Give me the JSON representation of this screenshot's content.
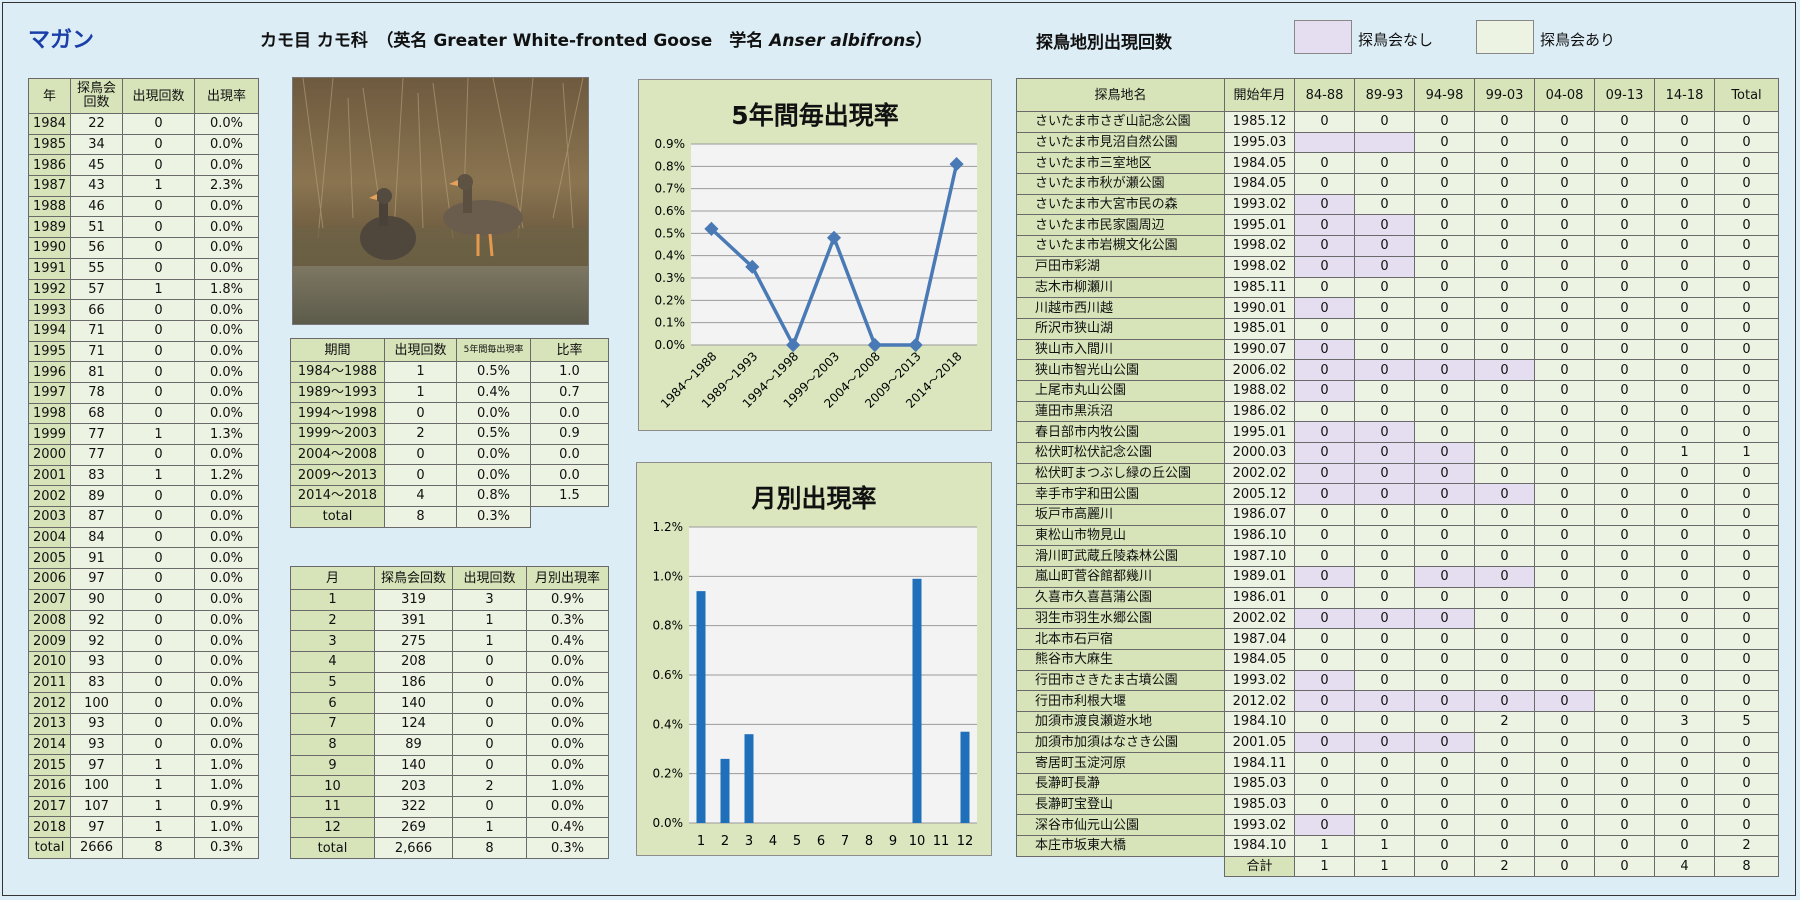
{
  "title": "マガン",
  "header": {
    "classification": "カモ目 カモ科",
    "english_prefix": "（英名 Greater White-fronted Goose",
    "sci_prefix": "学名",
    "sci_name": "Anser albifrons",
    "close": "）"
  },
  "site_section_title": "探鳥地別出現回数",
  "legend": [
    {
      "label": "探鳥会なし",
      "color": "#e5def0"
    },
    {
      "label": "探鳥会あり",
      "color": "#edf3e2"
    }
  ],
  "photo": {
    "alt_icon": "goose-photo"
  },
  "yearly": {
    "headers": [
      "年",
      "探鳥会回数",
      "出現回数",
      "出現率"
    ],
    "rows": [
      [
        "1984",
        "22",
        "0",
        "0.0%"
      ],
      [
        "1985",
        "34",
        "0",
        "0.0%"
      ],
      [
        "1986",
        "45",
        "0",
        "0.0%"
      ],
      [
        "1987",
        "43",
        "1",
        "2.3%"
      ],
      [
        "1988",
        "46",
        "0",
        "0.0%"
      ],
      [
        "1989",
        "51",
        "0",
        "0.0%"
      ],
      [
        "1990",
        "56",
        "0",
        "0.0%"
      ],
      [
        "1991",
        "55",
        "0",
        "0.0%"
      ],
      [
        "1992",
        "57",
        "1",
        "1.8%"
      ],
      [
        "1993",
        "66",
        "0",
        "0.0%"
      ],
      [
        "1994",
        "71",
        "0",
        "0.0%"
      ],
      [
        "1995",
        "71",
        "0",
        "0.0%"
      ],
      [
        "1996",
        "81",
        "0",
        "0.0%"
      ],
      [
        "1997",
        "78",
        "0",
        "0.0%"
      ],
      [
        "1998",
        "68",
        "0",
        "0.0%"
      ],
      [
        "1999",
        "77",
        "1",
        "1.3%"
      ],
      [
        "2000",
        "77",
        "0",
        "0.0%"
      ],
      [
        "2001",
        "83",
        "1",
        "1.2%"
      ],
      [
        "2002",
        "89",
        "0",
        "0.0%"
      ],
      [
        "2003",
        "87",
        "0",
        "0.0%"
      ],
      [
        "2004",
        "84",
        "0",
        "0.0%"
      ],
      [
        "2005",
        "91",
        "0",
        "0.0%"
      ],
      [
        "2006",
        "97",
        "0",
        "0.0%"
      ],
      [
        "2007",
        "90",
        "0",
        "0.0%"
      ],
      [
        "2008",
        "92",
        "0",
        "0.0%"
      ],
      [
        "2009",
        "92",
        "0",
        "0.0%"
      ],
      [
        "2010",
        "93",
        "0",
        "0.0%"
      ],
      [
        "2011",
        "83",
        "0",
        "0.0%"
      ],
      [
        "2012",
        "100",
        "0",
        "0.0%"
      ],
      [
        "2013",
        "93",
        "0",
        "0.0%"
      ],
      [
        "2014",
        "93",
        "0",
        "0.0%"
      ],
      [
        "2015",
        "97",
        "1",
        "1.0%"
      ],
      [
        "2016",
        "100",
        "1",
        "1.0%"
      ],
      [
        "2017",
        "107",
        "1",
        "0.9%"
      ],
      [
        "2018",
        "97",
        "1",
        "1.0%"
      ]
    ],
    "total": [
      "total",
      "2666",
      "8",
      "0.3%"
    ]
  },
  "period": {
    "headers": [
      "期間",
      "出現回数",
      "5年間毎出現率",
      "比率"
    ],
    "rows": [
      [
        "1984～1988",
        "1",
        "0.5%",
        "1.0"
      ],
      [
        "1989～1993",
        "1",
        "0.4%",
        "0.7"
      ],
      [
        "1994～1998",
        "0",
        "0.0%",
        "0.0"
      ],
      [
        "1999～2003",
        "2",
        "0.5%",
        "0.9"
      ],
      [
        "2004～2008",
        "0",
        "0.0%",
        "0.0"
      ],
      [
        "2009～2013",
        "0",
        "0.0%",
        "0.0"
      ],
      [
        "2014～2018",
        "4",
        "0.8%",
        "1.5"
      ]
    ],
    "total": [
      "total",
      "8",
      "0.3%"
    ]
  },
  "monthly": {
    "headers": [
      "月",
      "探鳥会回数",
      "出現回数",
      "月別出現率"
    ],
    "rows": [
      [
        "1",
        "319",
        "3",
        "0.9%"
      ],
      [
        "2",
        "391",
        "1",
        "0.3%"
      ],
      [
        "3",
        "275",
        "1",
        "0.4%"
      ],
      [
        "4",
        "208",
        "0",
        "0.0%"
      ],
      [
        "5",
        "186",
        "0",
        "0.0%"
      ],
      [
        "6",
        "140",
        "0",
        "0.0%"
      ],
      [
        "7",
        "124",
        "0",
        "0.0%"
      ],
      [
        "8",
        "89",
        "0",
        "0.0%"
      ],
      [
        "9",
        "140",
        "0",
        "0.0%"
      ],
      [
        "10",
        "203",
        "2",
        "1.0%"
      ],
      [
        "11",
        "322",
        "0",
        "0.0%"
      ],
      [
        "12",
        "269",
        "1",
        "0.4%"
      ]
    ],
    "total": [
      "total",
      "2,666",
      "8",
      "0.3%"
    ]
  },
  "chart_data": [
    {
      "type": "line",
      "title": "5年間毎出現率",
      "categories": [
        "1984～1988",
        "1989～1993",
        "1994～1998",
        "1999～2003",
        "2004～2008",
        "2009～2013",
        "2014～2018"
      ],
      "values": [
        0.52,
        0.35,
        0.0,
        0.48,
        0.0,
        0.0,
        0.81
      ],
      "yticks": [
        "0.0%",
        "0.1%",
        "0.2%",
        "0.3%",
        "0.4%",
        "0.5%",
        "0.6%",
        "0.7%",
        "0.8%",
        "0.9%"
      ],
      "ylim": [
        0,
        0.9
      ],
      "color": "#4a7ab5",
      "grid": true
    },
    {
      "type": "bar",
      "title": "月別出現率",
      "categories": [
        "1",
        "2",
        "3",
        "4",
        "5",
        "6",
        "7",
        "8",
        "9",
        "10",
        "11",
        "12"
      ],
      "values": [
        0.94,
        0.26,
        0.36,
        0,
        0,
        0,
        0,
        0,
        0,
        0.99,
        0,
        0.37
      ],
      "yticks": [
        "0.0%",
        "0.2%",
        "0.4%",
        "0.6%",
        "0.8%",
        "1.0%",
        "1.2%"
      ],
      "ylim": [
        0,
        1.2
      ],
      "color": "#1f6fba",
      "grid": true
    }
  ],
  "sites": {
    "headers": [
      "探鳥地名",
      "開始年月",
      "84-88",
      "89-93",
      "94-98",
      "99-03",
      "04-08",
      "09-13",
      "14-18",
      "Total"
    ],
    "rows": [
      {
        "cells": [
          "さいたま市さぎ山記念公園",
          "1985.12",
          "0",
          "0",
          "0",
          "0",
          "0",
          "0",
          "0",
          "0"
        ],
        "purple": []
      },
      {
        "cells": [
          "さいたま市見沼自然公園",
          "1995.03",
          "",
          "",
          "0",
          "0",
          "0",
          "0",
          "0",
          "0"
        ],
        "purple": [
          2,
          3
        ]
      },
      {
        "cells": [
          "さいたま市三室地区",
          "1984.05",
          "0",
          "0",
          "0",
          "0",
          "0",
          "0",
          "0",
          "0"
        ],
        "purple": []
      },
      {
        "cells": [
          "さいたま市秋が瀬公園",
          "1984.05",
          "0",
          "0",
          "0",
          "0",
          "0",
          "0",
          "0",
          "0"
        ],
        "purple": []
      },
      {
        "cells": [
          "さいたま市大宮市民の森",
          "1993.02",
          "0",
          "0",
          "0",
          "0",
          "0",
          "0",
          "0",
          "0"
        ],
        "purple": [
          2
        ]
      },
      {
        "cells": [
          "さいたま市民家園周辺",
          "1995.01",
          "0",
          "0",
          "0",
          "0",
          "0",
          "0",
          "0",
          "0"
        ],
        "purple": [
          2,
          3
        ]
      },
      {
        "cells": [
          "さいたま市岩槻文化公園",
          "1998.02",
          "0",
          "0",
          "0",
          "0",
          "0",
          "0",
          "0",
          "0"
        ],
        "purple": [
          2,
          3
        ]
      },
      {
        "cells": [
          "戸田市彩湖",
          "1998.02",
          "0",
          "0",
          "0",
          "0",
          "0",
          "0",
          "0",
          "0"
        ],
        "purple": [
          2,
          3
        ]
      },
      {
        "cells": [
          "志木市柳瀬川",
          "1985.11",
          "0",
          "0",
          "0",
          "0",
          "0",
          "0",
          "0",
          "0"
        ],
        "purple": []
      },
      {
        "cells": [
          "川越市西川越",
          "1990.01",
          "0",
          "0",
          "0",
          "0",
          "0",
          "0",
          "0",
          "0"
        ],
        "purple": [
          2
        ]
      },
      {
        "cells": [
          "所沢市狭山湖",
          "1985.01",
          "0",
          "0",
          "0",
          "0",
          "0",
          "0",
          "0",
          "0"
        ],
        "purple": []
      },
      {
        "cells": [
          "狭山市入間川",
          "1990.07",
          "0",
          "0",
          "0",
          "0",
          "0",
          "0",
          "0",
          "0"
        ],
        "purple": [
          2
        ]
      },
      {
        "cells": [
          "狭山市智光山公園",
          "2006.02",
          "0",
          "0",
          "0",
          "0",
          "0",
          "0",
          "0",
          "0"
        ],
        "purple": [
          2,
          3,
          4,
          5
        ]
      },
      {
        "cells": [
          "上尾市丸山公園",
          "1988.02",
          "0",
          "0",
          "0",
          "0",
          "0",
          "0",
          "0",
          "0"
        ],
        "purple": [
          2
        ]
      },
      {
        "cells": [
          "蓮田市黒浜沼",
          "1986.02",
          "0",
          "0",
          "0",
          "0",
          "0",
          "0",
          "0",
          "0"
        ],
        "purple": []
      },
      {
        "cells": [
          "春日部市内牧公園",
          "1995.01",
          "0",
          "0",
          "0",
          "0",
          "0",
          "0",
          "0",
          "0"
        ],
        "purple": [
          2,
          3
        ]
      },
      {
        "cells": [
          "松伏町松伏記念公園",
          "2000.03",
          "0",
          "0",
          "0",
          "0",
          "0",
          "0",
          "1",
          "1"
        ],
        "purple": [
          2,
          3,
          4
        ]
      },
      {
        "cells": [
          "松伏町まつぶし緑の丘公園",
          "2002.02",
          "0",
          "0",
          "0",
          "0",
          "0",
          "0",
          "0",
          "0"
        ],
        "purple": [
          2,
          3,
          4
        ]
      },
      {
        "cells": [
          "幸手市宇和田公園",
          "2005.12",
          "0",
          "0",
          "0",
          "0",
          "0",
          "0",
          "0",
          "0"
        ],
        "purple": [
          2,
          3,
          4,
          5
        ]
      },
      {
        "cells": [
          "坂戸市高麗川",
          "1986.07",
          "0",
          "0",
          "0",
          "0",
          "0",
          "0",
          "0",
          "0"
        ],
        "purple": []
      },
      {
        "cells": [
          "東松山市物見山",
          "1986.10",
          "0",
          "0",
          "0",
          "0",
          "0",
          "0",
          "0",
          "0"
        ],
        "purple": []
      },
      {
        "cells": [
          "滑川町武蔵丘陵森林公園",
          "1987.10",
          "0",
          "0",
          "0",
          "0",
          "0",
          "0",
          "0",
          "0"
        ],
        "purple": []
      },
      {
        "cells": [
          "嵐山町菅谷館都幾川",
          "1989.01",
          "0",
          "0",
          "0",
          "0",
          "0",
          "0",
          "0",
          "0"
        ],
        "purple": [
          2,
          4,
          5
        ]
      },
      {
        "cells": [
          "久喜市久喜菖蒲公園",
          "1986.01",
          "0",
          "0",
          "0",
          "0",
          "0",
          "0",
          "0",
          "0"
        ],
        "purple": []
      },
      {
        "cells": [
          "羽生市羽生水郷公園",
          "2002.02",
          "0",
          "0",
          "0",
          "0",
          "0",
          "0",
          "0",
          "0"
        ],
        "purple": [
          2,
          3,
          4
        ]
      },
      {
        "cells": [
          "北本市石戸宿",
          "1987.04",
          "0",
          "0",
          "0",
          "0",
          "0",
          "0",
          "0",
          "0"
        ],
        "purple": []
      },
      {
        "cells": [
          "熊谷市大麻生",
          "1984.05",
          "0",
          "0",
          "0",
          "0",
          "0",
          "0",
          "0",
          "0"
        ],
        "purple": []
      },
      {
        "cells": [
          "行田市さきたま古墳公園",
          "1993.02",
          "0",
          "0",
          "0",
          "0",
          "0",
          "0",
          "0",
          "0"
        ],
        "purple": [
          2
        ]
      },
      {
        "cells": [
          "行田市利根大堰",
          "2012.02",
          "0",
          "0",
          "0",
          "0",
          "0",
          "0",
          "0",
          "0"
        ],
        "purple": [
          2,
          3,
          4,
          5,
          6
        ]
      },
      {
        "cells": [
          "加須市渡良瀬遊水地",
          "1984.10",
          "0",
          "0",
          "0",
          "2",
          "0",
          "0",
          "3",
          "5"
        ],
        "purple": []
      },
      {
        "cells": [
          "加須市加須はなさき公園",
          "2001.05",
          "0",
          "0",
          "0",
          "0",
          "0",
          "0",
          "0",
          "0"
        ],
        "purple": [
          2,
          3,
          4
        ]
      },
      {
        "cells": [
          "寄居町玉淀河原",
          "1984.11",
          "0",
          "0",
          "0",
          "0",
          "0",
          "0",
          "0",
          "0"
        ],
        "purple": []
      },
      {
        "cells": [
          "長瀞町長瀞",
          "1985.03",
          "0",
          "0",
          "0",
          "0",
          "0",
          "0",
          "0",
          "0"
        ],
        "purple": []
      },
      {
        "cells": [
          "長瀞町宝登山",
          "1985.03",
          "0",
          "0",
          "0",
          "0",
          "0",
          "0",
          "0",
          "0"
        ],
        "purple": []
      },
      {
        "cells": [
          "深谷市仙元山公園",
          "1993.02",
          "0",
          "0",
          "0",
          "0",
          "0",
          "0",
          "0",
          "0"
        ],
        "purple": [
          2
        ]
      },
      {
        "cells": [
          "本庄市坂東大橋",
          "1984.10",
          "1",
          "1",
          "0",
          "0",
          "0",
          "0",
          "0",
          "2"
        ],
        "purple": []
      }
    ],
    "total": [
      "合計",
      "1",
      "1",
      "0",
      "2",
      "0",
      "0",
      "4",
      "8"
    ]
  }
}
